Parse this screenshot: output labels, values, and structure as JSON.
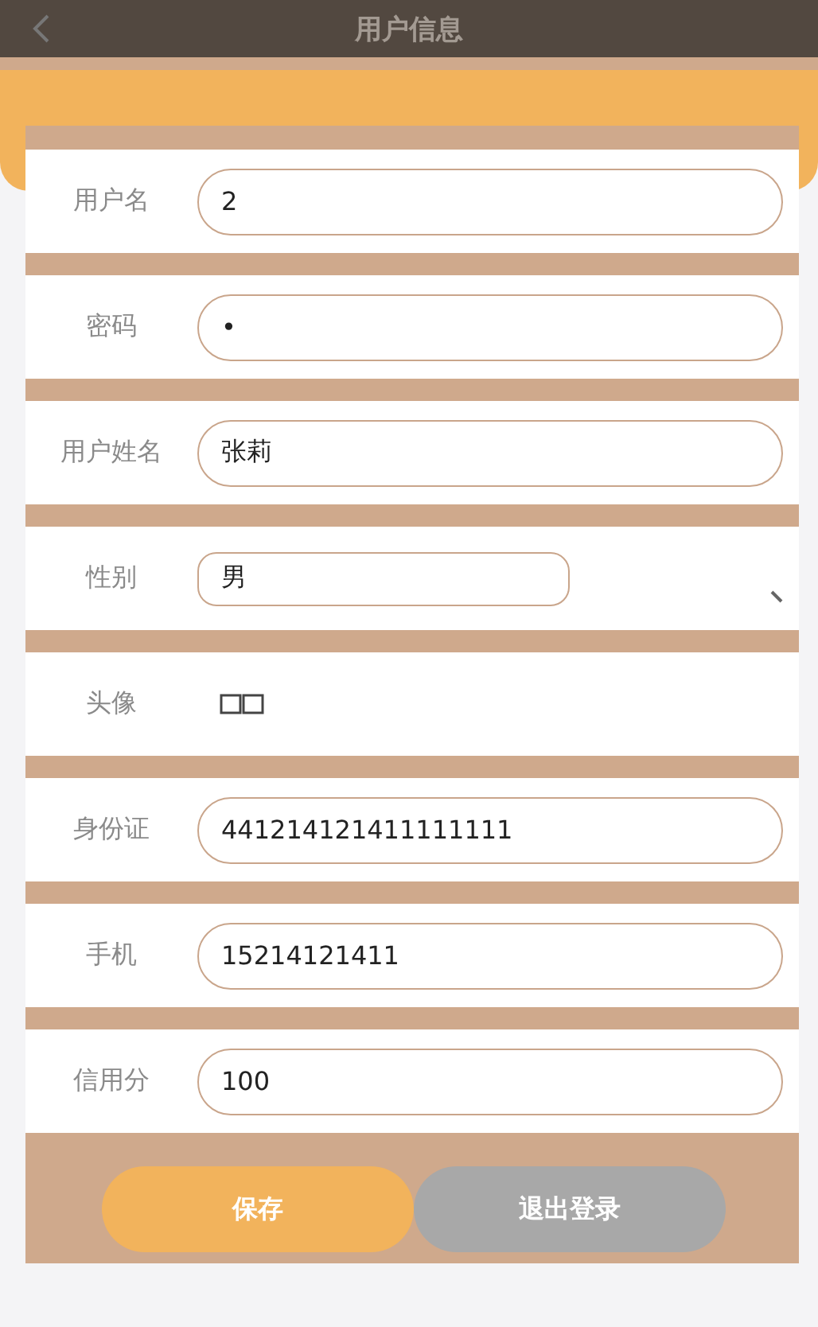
{
  "header": {
    "title": "用户信息"
  },
  "fields": [
    {
      "kind": "text",
      "label": "用户名",
      "value": "2"
    },
    {
      "kind": "text",
      "label": "密码",
      "value": "•"
    },
    {
      "kind": "text",
      "label": "用户姓名",
      "value": "张莉"
    },
    {
      "kind": "select",
      "label": "性别",
      "value": "男"
    },
    {
      "kind": "image",
      "label": "头像"
    },
    {
      "kind": "text",
      "label": "身份证",
      "value": "441214121411111111"
    },
    {
      "kind": "text",
      "label": "手机",
      "value": "15214121411"
    },
    {
      "kind": "text",
      "label": "信用分",
      "value": "100"
    }
  ],
  "buttons": [
    {
      "kind": "primary",
      "label": "保存"
    },
    {
      "kind": "secondary",
      "label": "退出登录"
    }
  ]
}
